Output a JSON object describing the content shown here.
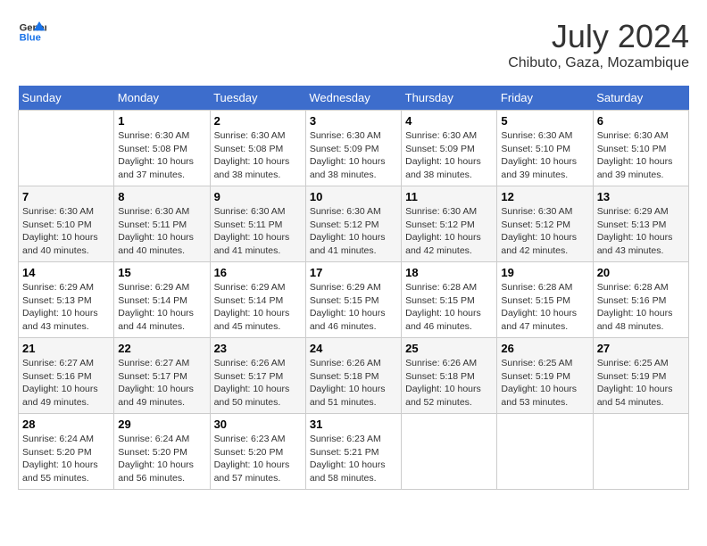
{
  "logo": {
    "line1": "General",
    "line2": "Blue"
  },
  "title": "July 2024",
  "subtitle": "Chibuto, Gaza, Mozambique",
  "days_of_week": [
    "Sunday",
    "Monday",
    "Tuesday",
    "Wednesday",
    "Thursday",
    "Friday",
    "Saturday"
  ],
  "weeks": [
    [
      {
        "day": "",
        "info": ""
      },
      {
        "day": "1",
        "info": "Sunrise: 6:30 AM\nSunset: 5:08 PM\nDaylight: 10 hours\nand 37 minutes."
      },
      {
        "day": "2",
        "info": "Sunrise: 6:30 AM\nSunset: 5:08 PM\nDaylight: 10 hours\nand 38 minutes."
      },
      {
        "day": "3",
        "info": "Sunrise: 6:30 AM\nSunset: 5:09 PM\nDaylight: 10 hours\nand 38 minutes."
      },
      {
        "day": "4",
        "info": "Sunrise: 6:30 AM\nSunset: 5:09 PM\nDaylight: 10 hours\nand 38 minutes."
      },
      {
        "day": "5",
        "info": "Sunrise: 6:30 AM\nSunset: 5:10 PM\nDaylight: 10 hours\nand 39 minutes."
      },
      {
        "day": "6",
        "info": "Sunrise: 6:30 AM\nSunset: 5:10 PM\nDaylight: 10 hours\nand 39 minutes."
      }
    ],
    [
      {
        "day": "7",
        "info": "Sunrise: 6:30 AM\nSunset: 5:10 PM\nDaylight: 10 hours\nand 40 minutes."
      },
      {
        "day": "8",
        "info": "Sunrise: 6:30 AM\nSunset: 5:11 PM\nDaylight: 10 hours\nand 40 minutes."
      },
      {
        "day": "9",
        "info": "Sunrise: 6:30 AM\nSunset: 5:11 PM\nDaylight: 10 hours\nand 41 minutes."
      },
      {
        "day": "10",
        "info": "Sunrise: 6:30 AM\nSunset: 5:12 PM\nDaylight: 10 hours\nand 41 minutes."
      },
      {
        "day": "11",
        "info": "Sunrise: 6:30 AM\nSunset: 5:12 PM\nDaylight: 10 hours\nand 42 minutes."
      },
      {
        "day": "12",
        "info": "Sunrise: 6:30 AM\nSunset: 5:12 PM\nDaylight: 10 hours\nand 42 minutes."
      },
      {
        "day": "13",
        "info": "Sunrise: 6:29 AM\nSunset: 5:13 PM\nDaylight: 10 hours\nand 43 minutes."
      }
    ],
    [
      {
        "day": "14",
        "info": "Sunrise: 6:29 AM\nSunset: 5:13 PM\nDaylight: 10 hours\nand 43 minutes."
      },
      {
        "day": "15",
        "info": "Sunrise: 6:29 AM\nSunset: 5:14 PM\nDaylight: 10 hours\nand 44 minutes."
      },
      {
        "day": "16",
        "info": "Sunrise: 6:29 AM\nSunset: 5:14 PM\nDaylight: 10 hours\nand 45 minutes."
      },
      {
        "day": "17",
        "info": "Sunrise: 6:29 AM\nSunset: 5:15 PM\nDaylight: 10 hours\nand 46 minutes."
      },
      {
        "day": "18",
        "info": "Sunrise: 6:28 AM\nSunset: 5:15 PM\nDaylight: 10 hours\nand 46 minutes."
      },
      {
        "day": "19",
        "info": "Sunrise: 6:28 AM\nSunset: 5:15 PM\nDaylight: 10 hours\nand 47 minutes."
      },
      {
        "day": "20",
        "info": "Sunrise: 6:28 AM\nSunset: 5:16 PM\nDaylight: 10 hours\nand 48 minutes."
      }
    ],
    [
      {
        "day": "21",
        "info": "Sunrise: 6:27 AM\nSunset: 5:16 PM\nDaylight: 10 hours\nand 49 minutes."
      },
      {
        "day": "22",
        "info": "Sunrise: 6:27 AM\nSunset: 5:17 PM\nDaylight: 10 hours\nand 49 minutes."
      },
      {
        "day": "23",
        "info": "Sunrise: 6:26 AM\nSunset: 5:17 PM\nDaylight: 10 hours\nand 50 minutes."
      },
      {
        "day": "24",
        "info": "Sunrise: 6:26 AM\nSunset: 5:18 PM\nDaylight: 10 hours\nand 51 minutes."
      },
      {
        "day": "25",
        "info": "Sunrise: 6:26 AM\nSunset: 5:18 PM\nDaylight: 10 hours\nand 52 minutes."
      },
      {
        "day": "26",
        "info": "Sunrise: 6:25 AM\nSunset: 5:19 PM\nDaylight: 10 hours\nand 53 minutes."
      },
      {
        "day": "27",
        "info": "Sunrise: 6:25 AM\nSunset: 5:19 PM\nDaylight: 10 hours\nand 54 minutes."
      }
    ],
    [
      {
        "day": "28",
        "info": "Sunrise: 6:24 AM\nSunset: 5:20 PM\nDaylight: 10 hours\nand 55 minutes."
      },
      {
        "day": "29",
        "info": "Sunrise: 6:24 AM\nSunset: 5:20 PM\nDaylight: 10 hours\nand 56 minutes."
      },
      {
        "day": "30",
        "info": "Sunrise: 6:23 AM\nSunset: 5:20 PM\nDaylight: 10 hours\nand 57 minutes."
      },
      {
        "day": "31",
        "info": "Sunrise: 6:23 AM\nSunset: 5:21 PM\nDaylight: 10 hours\nand 58 minutes."
      },
      {
        "day": "",
        "info": ""
      },
      {
        "day": "",
        "info": ""
      },
      {
        "day": "",
        "info": ""
      }
    ]
  ]
}
